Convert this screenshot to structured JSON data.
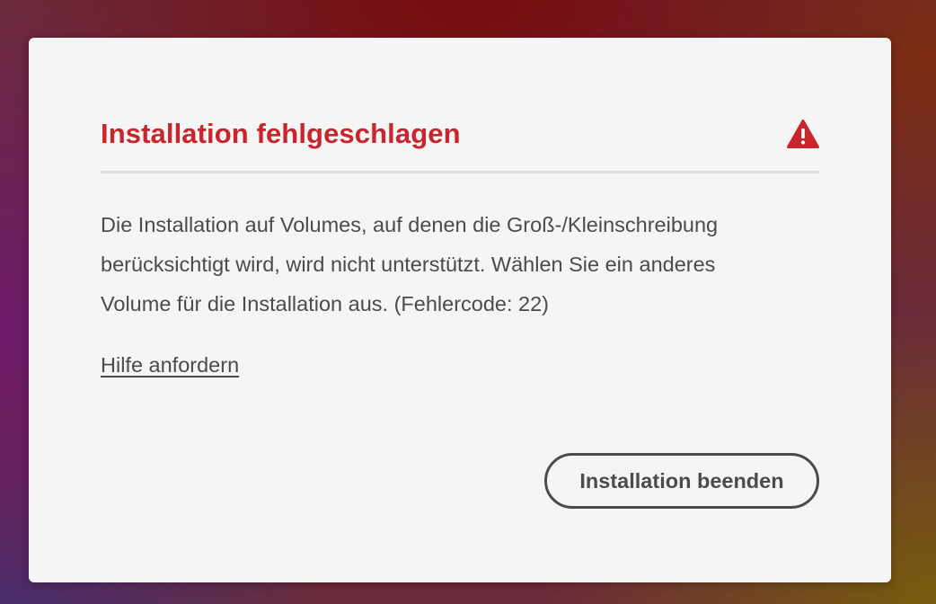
{
  "dialog": {
    "title": "Installation fehlgeschlagen",
    "title_color": "#c9252c",
    "alert_icon": "alert-triangle-icon",
    "message_lines": [
      "Die Installation auf Volumes, auf denen die Groß-/Kleinschreibung",
      "berücksichtigt wird, wird nicht unterstützt. Wählen Sie ein anderes",
      "Volume für die Installation aus. (Fehlercode: 22)"
    ],
    "help_link": "Hilfe anfordern",
    "quit_button": "Installation beenden"
  }
}
